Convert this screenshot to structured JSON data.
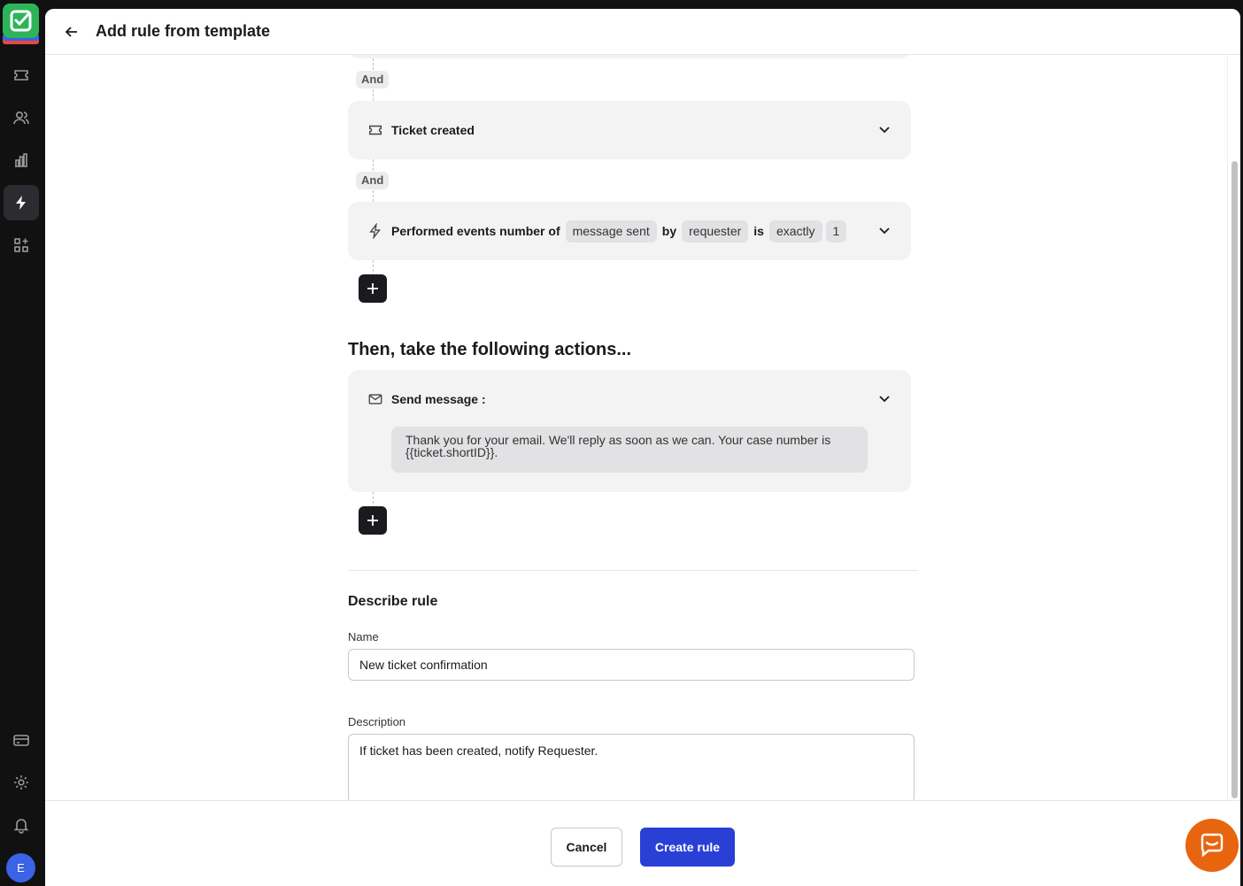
{
  "header": {
    "title": "Add rule from template"
  },
  "conditions": {
    "connector": "And",
    "ticket_created": "Ticket created",
    "performed": {
      "prefix": "Performed events number of",
      "event": "message sent",
      "by_word": "by",
      "actor": "requester",
      "is_word": "is",
      "operator": "exactly",
      "count": "1"
    }
  },
  "actions": {
    "title": "Then, take the following actions...",
    "send_message_label": "Send message :",
    "message_text": "Thank you for your email. We'll reply as soon as we can. Your case number is {{ticket.shortID}}."
  },
  "describe": {
    "title": "Describe rule",
    "name_label": "Name",
    "name_value": "New ticket confirmation",
    "description_label": "Description",
    "description_value": "If ticket has been created, notify Requester."
  },
  "footer": {
    "cancel": "Cancel",
    "create": "Create rule"
  },
  "sidebar": {
    "avatar_initial": "E"
  },
  "colors": {
    "primary": "#2a3fd6",
    "chat": "#e8650f",
    "logo": "#2db45a"
  }
}
